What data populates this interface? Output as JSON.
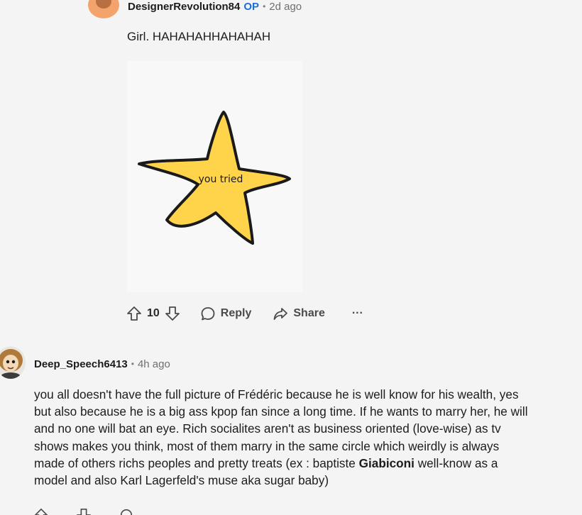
{
  "comment1": {
    "username": "DesignerRevolution84",
    "op_badge": "OP",
    "separator": "•",
    "time": "2d ago",
    "text": "Girl. HAHAHAHHAHAHAH",
    "image": {
      "caption": "you tried",
      "star_color": "#ffd44a"
    },
    "actions": {
      "upvote_icon": "upvote-arrow-icon",
      "vote_count": "10",
      "downvote_icon": "downvote-arrow-icon",
      "reply_label": "Reply",
      "share_label": "Share",
      "more_label": "···"
    }
  },
  "comment2": {
    "username": "Deep_Speech6413",
    "separator": "•",
    "time": "4h ago",
    "body_lines": [
      {
        "before": "you all doesn't have the full picture of Frédéric because he is well know for his wealth, yes",
        "bold": "",
        "after": ""
      },
      {
        "before": "but also because he is a big ass kpop fan since a long time. If he wants to marry her, he will",
        "bold": "",
        "after": ""
      },
      {
        "before": "and no one will bat an eye. Rich socialites aren't as business oriented (love-wise) as tv",
        "bold": "",
        "after": ""
      },
      {
        "before": "shows makes you think, most of them marry in the same circle which weirdly is always",
        "bold": "",
        "after": ""
      },
      {
        "before": "made of others richs peoples and pretty treats (ex : baptiste ",
        "bold": "Giabiconi",
        "after": " well-know as a"
      },
      {
        "before": "model and also Karl Lagerfeld's muse aka sugar baby)",
        "bold": "",
        "after": ""
      }
    ]
  },
  "colors": {
    "background": "#f5f4f4",
    "op_blue": "#1a6fd4",
    "meta_gray": "#6f6f6f",
    "avatar1_orange": "#f3a36b"
  }
}
